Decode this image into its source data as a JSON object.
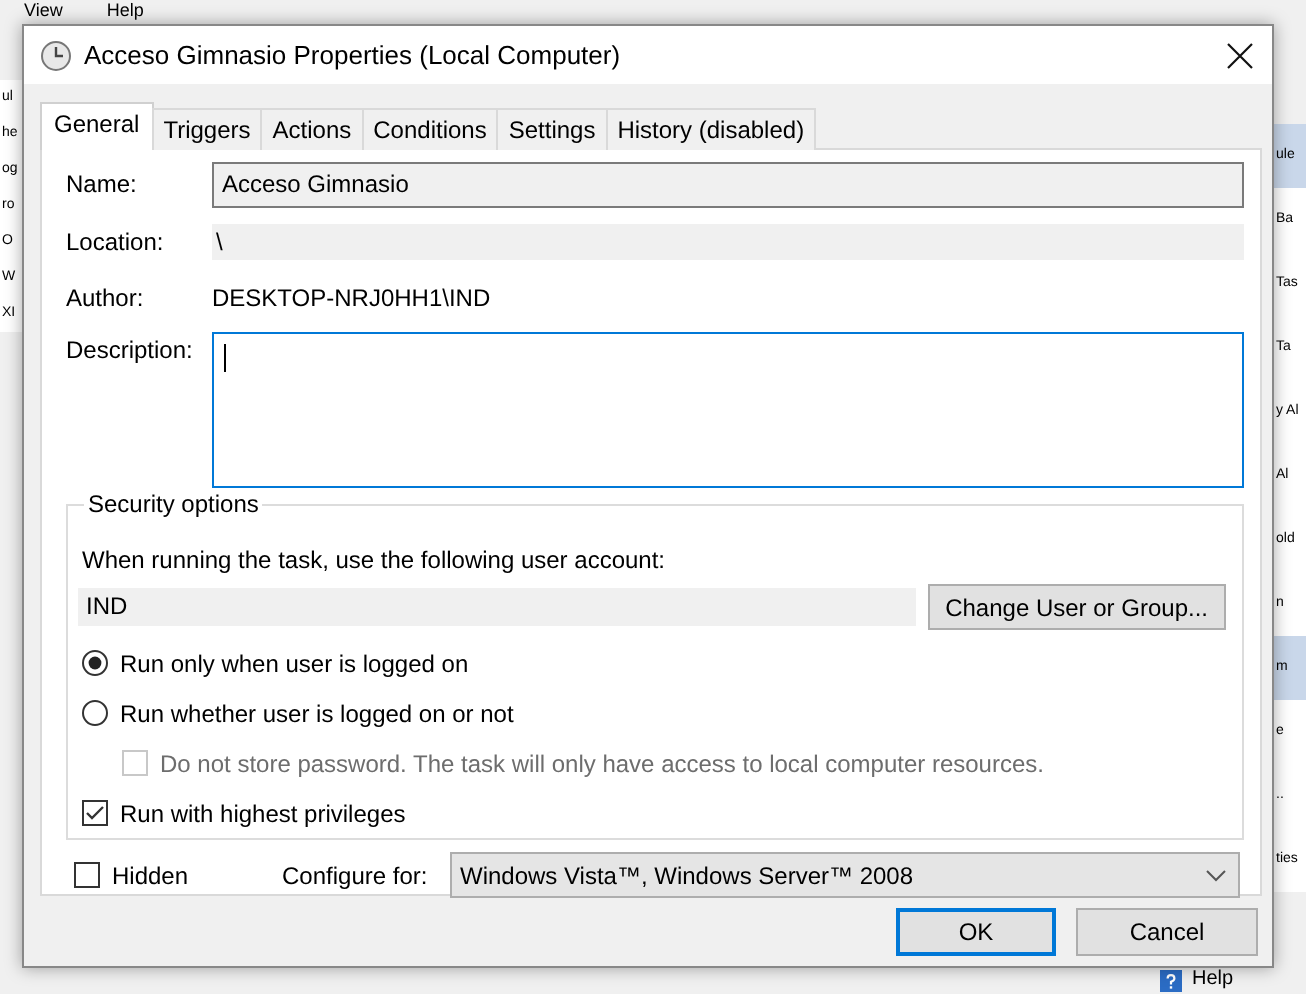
{
  "background": {
    "menu": [
      "View",
      "Help"
    ],
    "left_items": [
      "ul",
      "he",
      "og",
      "ro",
      "O",
      "W",
      "XI"
    ],
    "right_items": [
      {
        "text": "ule",
        "kind": "header"
      },
      {
        "text": "Ba",
        "kind": "item"
      },
      {
        "text": "Tas",
        "kind": "item"
      },
      {
        "text": "Ta",
        "kind": "item"
      },
      {
        "text": "y Al",
        "kind": "item"
      },
      {
        "text": "Al",
        "kind": "item"
      },
      {
        "text": "old",
        "kind": "item"
      },
      {
        "text": "n",
        "kind": "item"
      },
      {
        "text": "m",
        "kind": "header"
      },
      {
        "text": "e",
        "kind": "item"
      },
      {
        "text": "..",
        "kind": "item"
      },
      {
        "text": "ties",
        "kind": "item"
      }
    ],
    "help": "Help"
  },
  "window": {
    "title": "Acceso Gimnasio Properties (Local Computer)"
  },
  "tabs": [
    {
      "label": "General",
      "selected": true
    },
    {
      "label": "Triggers",
      "selected": false
    },
    {
      "label": "Actions",
      "selected": false
    },
    {
      "label": "Conditions",
      "selected": false
    },
    {
      "label": "Settings",
      "selected": false
    },
    {
      "label": "History (disabled)",
      "selected": false
    }
  ],
  "general": {
    "fields": [
      {
        "label": "Name:",
        "kind": "input",
        "value": "Acceso Gimnasio"
      },
      {
        "label": "Location:",
        "kind": "readonly",
        "value": "\\"
      },
      {
        "label": "Author:",
        "kind": "text",
        "value": "DESKTOP-NRJ0HH1\\IND"
      },
      {
        "label": "Description:",
        "kind": "textarea",
        "focused": true
      }
    ]
  },
  "security": {
    "title": "Security options",
    "prompt": "When running the task, use the following user account:",
    "account": "IND",
    "change_button": "Change User or Group...",
    "options": [
      {
        "kind": "radio",
        "label": "Run only when user is logged on",
        "selected": true,
        "disabled": false
      },
      {
        "kind": "radio",
        "label": "Run whether user is logged on or not",
        "selected": false,
        "disabled": false,
        "children": [
          {
            "kind": "checkbox",
            "label": "Do not store password.  The task will only have access to local computer resources.",
            "checked": false,
            "disabled": true
          }
        ]
      },
      {
        "kind": "checkbox",
        "label": "Run with highest privileges",
        "checked": true,
        "disabled": false
      }
    ]
  },
  "hidden": {
    "label": "Hidden",
    "checked": false
  },
  "configure": {
    "label": "Configure for:",
    "value": "Windows Vista™, Windows Server™ 2008"
  },
  "buttons": [
    {
      "label": "OK",
      "default": true
    },
    {
      "label": "Cancel",
      "default": false
    }
  ]
}
